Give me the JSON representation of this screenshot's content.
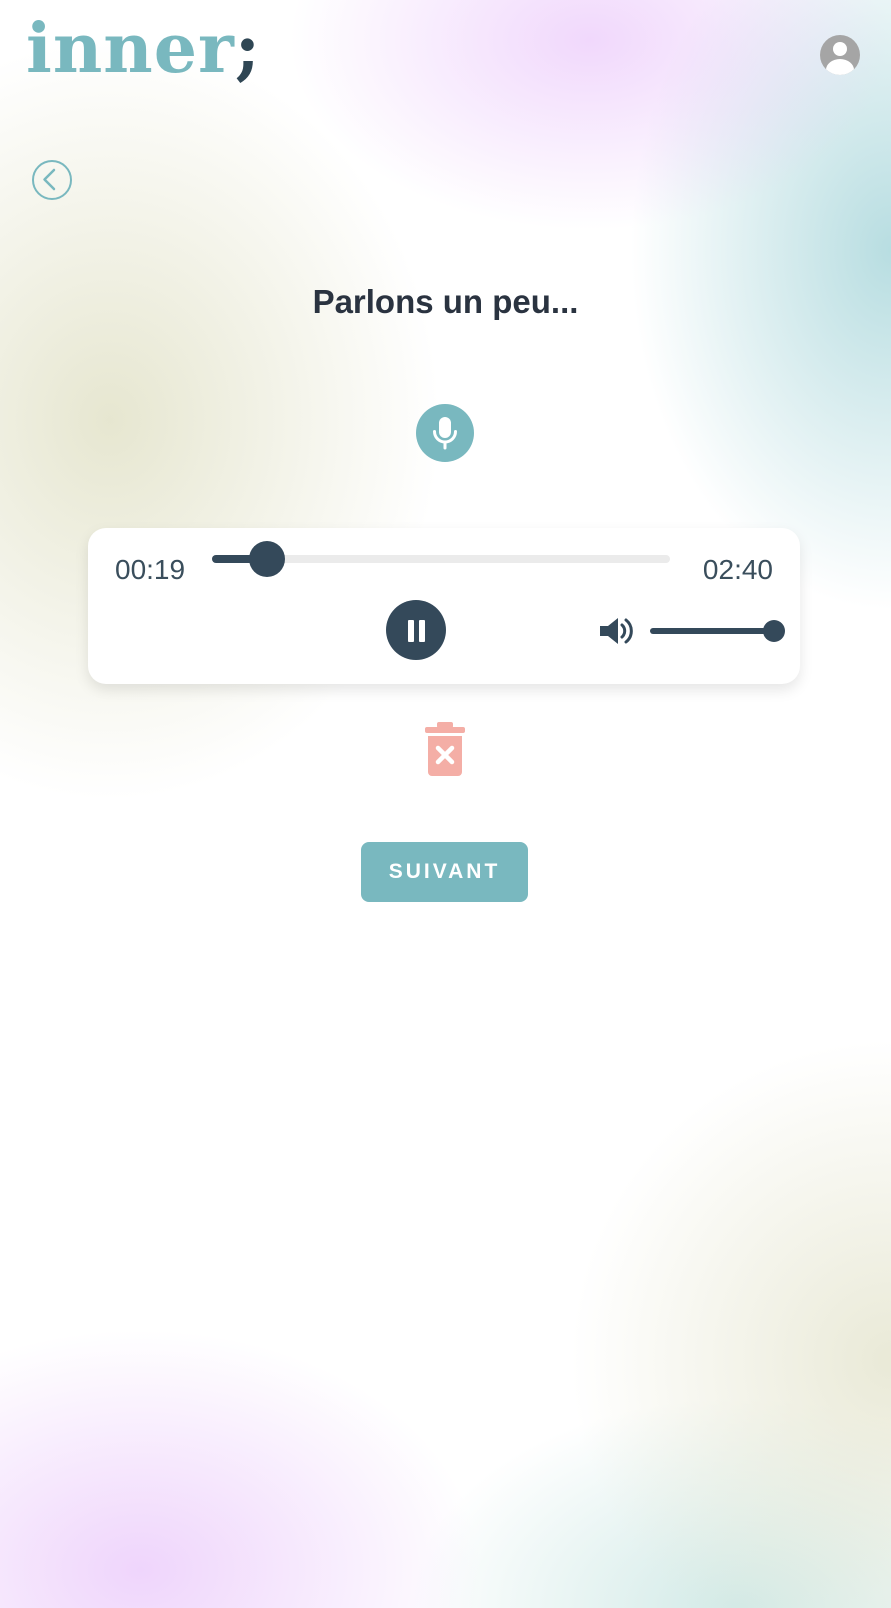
{
  "header": {
    "logo_text": "inner",
    "logo_punct": ";",
    "profile_icon": "user-circle-icon"
  },
  "navigation": {
    "back_icon": "chevron-left-circle-icon"
  },
  "main": {
    "title": "Parlons un peu...",
    "mic_icon": "microphone-icon"
  },
  "player": {
    "current_time": "00:19",
    "total_time": "02:40",
    "progress_fraction": 0.12,
    "is_playing": true,
    "play_state_icon": "pause-icon",
    "volume_icon": "speaker-volume-icon",
    "volume_fraction": 1.0
  },
  "actions": {
    "delete_icon": "trash-x-icon",
    "next_label": "SUIVANT"
  },
  "colors": {
    "accent": "#79b8bf",
    "dark": "#34495a",
    "delete": "#f4aea6",
    "text": "#2a3340"
  }
}
